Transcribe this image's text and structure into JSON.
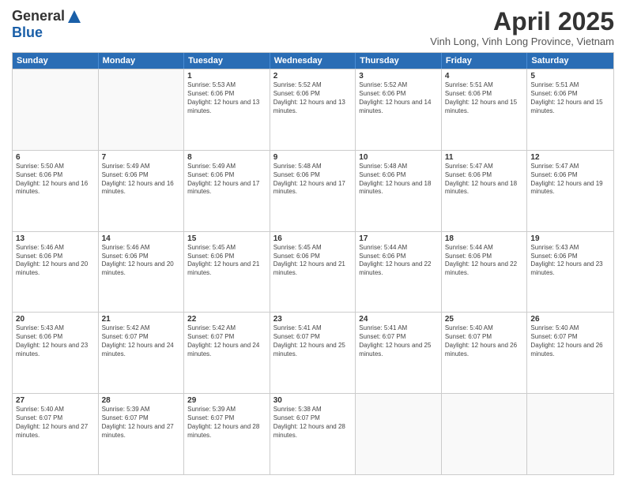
{
  "logo": {
    "general": "General",
    "blue": "Blue"
  },
  "title": "April 2025",
  "subtitle": "Vinh Long, Vinh Long Province, Vietnam",
  "header_days": [
    "Sunday",
    "Monday",
    "Tuesday",
    "Wednesday",
    "Thursday",
    "Friday",
    "Saturday"
  ],
  "weeks": [
    [
      {
        "day": "",
        "empty": true
      },
      {
        "day": "",
        "empty": true
      },
      {
        "day": "1",
        "sunrise": "Sunrise: 5:53 AM",
        "sunset": "Sunset: 6:06 PM",
        "daylight": "Daylight: 12 hours and 13 minutes."
      },
      {
        "day": "2",
        "sunrise": "Sunrise: 5:52 AM",
        "sunset": "Sunset: 6:06 PM",
        "daylight": "Daylight: 12 hours and 13 minutes."
      },
      {
        "day": "3",
        "sunrise": "Sunrise: 5:52 AM",
        "sunset": "Sunset: 6:06 PM",
        "daylight": "Daylight: 12 hours and 14 minutes."
      },
      {
        "day": "4",
        "sunrise": "Sunrise: 5:51 AM",
        "sunset": "Sunset: 6:06 PM",
        "daylight": "Daylight: 12 hours and 15 minutes."
      },
      {
        "day": "5",
        "sunrise": "Sunrise: 5:51 AM",
        "sunset": "Sunset: 6:06 PM",
        "daylight": "Daylight: 12 hours and 15 minutes."
      }
    ],
    [
      {
        "day": "6",
        "sunrise": "Sunrise: 5:50 AM",
        "sunset": "Sunset: 6:06 PM",
        "daylight": "Daylight: 12 hours and 16 minutes."
      },
      {
        "day": "7",
        "sunrise": "Sunrise: 5:49 AM",
        "sunset": "Sunset: 6:06 PM",
        "daylight": "Daylight: 12 hours and 16 minutes."
      },
      {
        "day": "8",
        "sunrise": "Sunrise: 5:49 AM",
        "sunset": "Sunset: 6:06 PM",
        "daylight": "Daylight: 12 hours and 17 minutes."
      },
      {
        "day": "9",
        "sunrise": "Sunrise: 5:48 AM",
        "sunset": "Sunset: 6:06 PM",
        "daylight": "Daylight: 12 hours and 17 minutes."
      },
      {
        "day": "10",
        "sunrise": "Sunrise: 5:48 AM",
        "sunset": "Sunset: 6:06 PM",
        "daylight": "Daylight: 12 hours and 18 minutes."
      },
      {
        "day": "11",
        "sunrise": "Sunrise: 5:47 AM",
        "sunset": "Sunset: 6:06 PM",
        "daylight": "Daylight: 12 hours and 18 minutes."
      },
      {
        "day": "12",
        "sunrise": "Sunrise: 5:47 AM",
        "sunset": "Sunset: 6:06 PM",
        "daylight": "Daylight: 12 hours and 19 minutes."
      }
    ],
    [
      {
        "day": "13",
        "sunrise": "Sunrise: 5:46 AM",
        "sunset": "Sunset: 6:06 PM",
        "daylight": "Daylight: 12 hours and 20 minutes."
      },
      {
        "day": "14",
        "sunrise": "Sunrise: 5:46 AM",
        "sunset": "Sunset: 6:06 PM",
        "daylight": "Daylight: 12 hours and 20 minutes."
      },
      {
        "day": "15",
        "sunrise": "Sunrise: 5:45 AM",
        "sunset": "Sunset: 6:06 PM",
        "daylight": "Daylight: 12 hours and 21 minutes."
      },
      {
        "day": "16",
        "sunrise": "Sunrise: 5:45 AM",
        "sunset": "Sunset: 6:06 PM",
        "daylight": "Daylight: 12 hours and 21 minutes."
      },
      {
        "day": "17",
        "sunrise": "Sunrise: 5:44 AM",
        "sunset": "Sunset: 6:06 PM",
        "daylight": "Daylight: 12 hours and 22 minutes."
      },
      {
        "day": "18",
        "sunrise": "Sunrise: 5:44 AM",
        "sunset": "Sunset: 6:06 PM",
        "daylight": "Daylight: 12 hours and 22 minutes."
      },
      {
        "day": "19",
        "sunrise": "Sunrise: 5:43 AM",
        "sunset": "Sunset: 6:06 PM",
        "daylight": "Daylight: 12 hours and 23 minutes."
      }
    ],
    [
      {
        "day": "20",
        "sunrise": "Sunrise: 5:43 AM",
        "sunset": "Sunset: 6:06 PM",
        "daylight": "Daylight: 12 hours and 23 minutes."
      },
      {
        "day": "21",
        "sunrise": "Sunrise: 5:42 AM",
        "sunset": "Sunset: 6:07 PM",
        "daylight": "Daylight: 12 hours and 24 minutes."
      },
      {
        "day": "22",
        "sunrise": "Sunrise: 5:42 AM",
        "sunset": "Sunset: 6:07 PM",
        "daylight": "Daylight: 12 hours and 24 minutes."
      },
      {
        "day": "23",
        "sunrise": "Sunrise: 5:41 AM",
        "sunset": "Sunset: 6:07 PM",
        "daylight": "Daylight: 12 hours and 25 minutes."
      },
      {
        "day": "24",
        "sunrise": "Sunrise: 5:41 AM",
        "sunset": "Sunset: 6:07 PM",
        "daylight": "Daylight: 12 hours and 25 minutes."
      },
      {
        "day": "25",
        "sunrise": "Sunrise: 5:40 AM",
        "sunset": "Sunset: 6:07 PM",
        "daylight": "Daylight: 12 hours and 26 minutes."
      },
      {
        "day": "26",
        "sunrise": "Sunrise: 5:40 AM",
        "sunset": "Sunset: 6:07 PM",
        "daylight": "Daylight: 12 hours and 26 minutes."
      }
    ],
    [
      {
        "day": "27",
        "sunrise": "Sunrise: 5:40 AM",
        "sunset": "Sunset: 6:07 PM",
        "daylight": "Daylight: 12 hours and 27 minutes."
      },
      {
        "day": "28",
        "sunrise": "Sunrise: 5:39 AM",
        "sunset": "Sunset: 6:07 PM",
        "daylight": "Daylight: 12 hours and 27 minutes."
      },
      {
        "day": "29",
        "sunrise": "Sunrise: 5:39 AM",
        "sunset": "Sunset: 6:07 PM",
        "daylight": "Daylight: 12 hours and 28 minutes."
      },
      {
        "day": "30",
        "sunrise": "Sunrise: 5:38 AM",
        "sunset": "Sunset: 6:07 PM",
        "daylight": "Daylight: 12 hours and 28 minutes."
      },
      {
        "day": "",
        "empty": true
      },
      {
        "day": "",
        "empty": true
      },
      {
        "day": "",
        "empty": true
      }
    ]
  ]
}
